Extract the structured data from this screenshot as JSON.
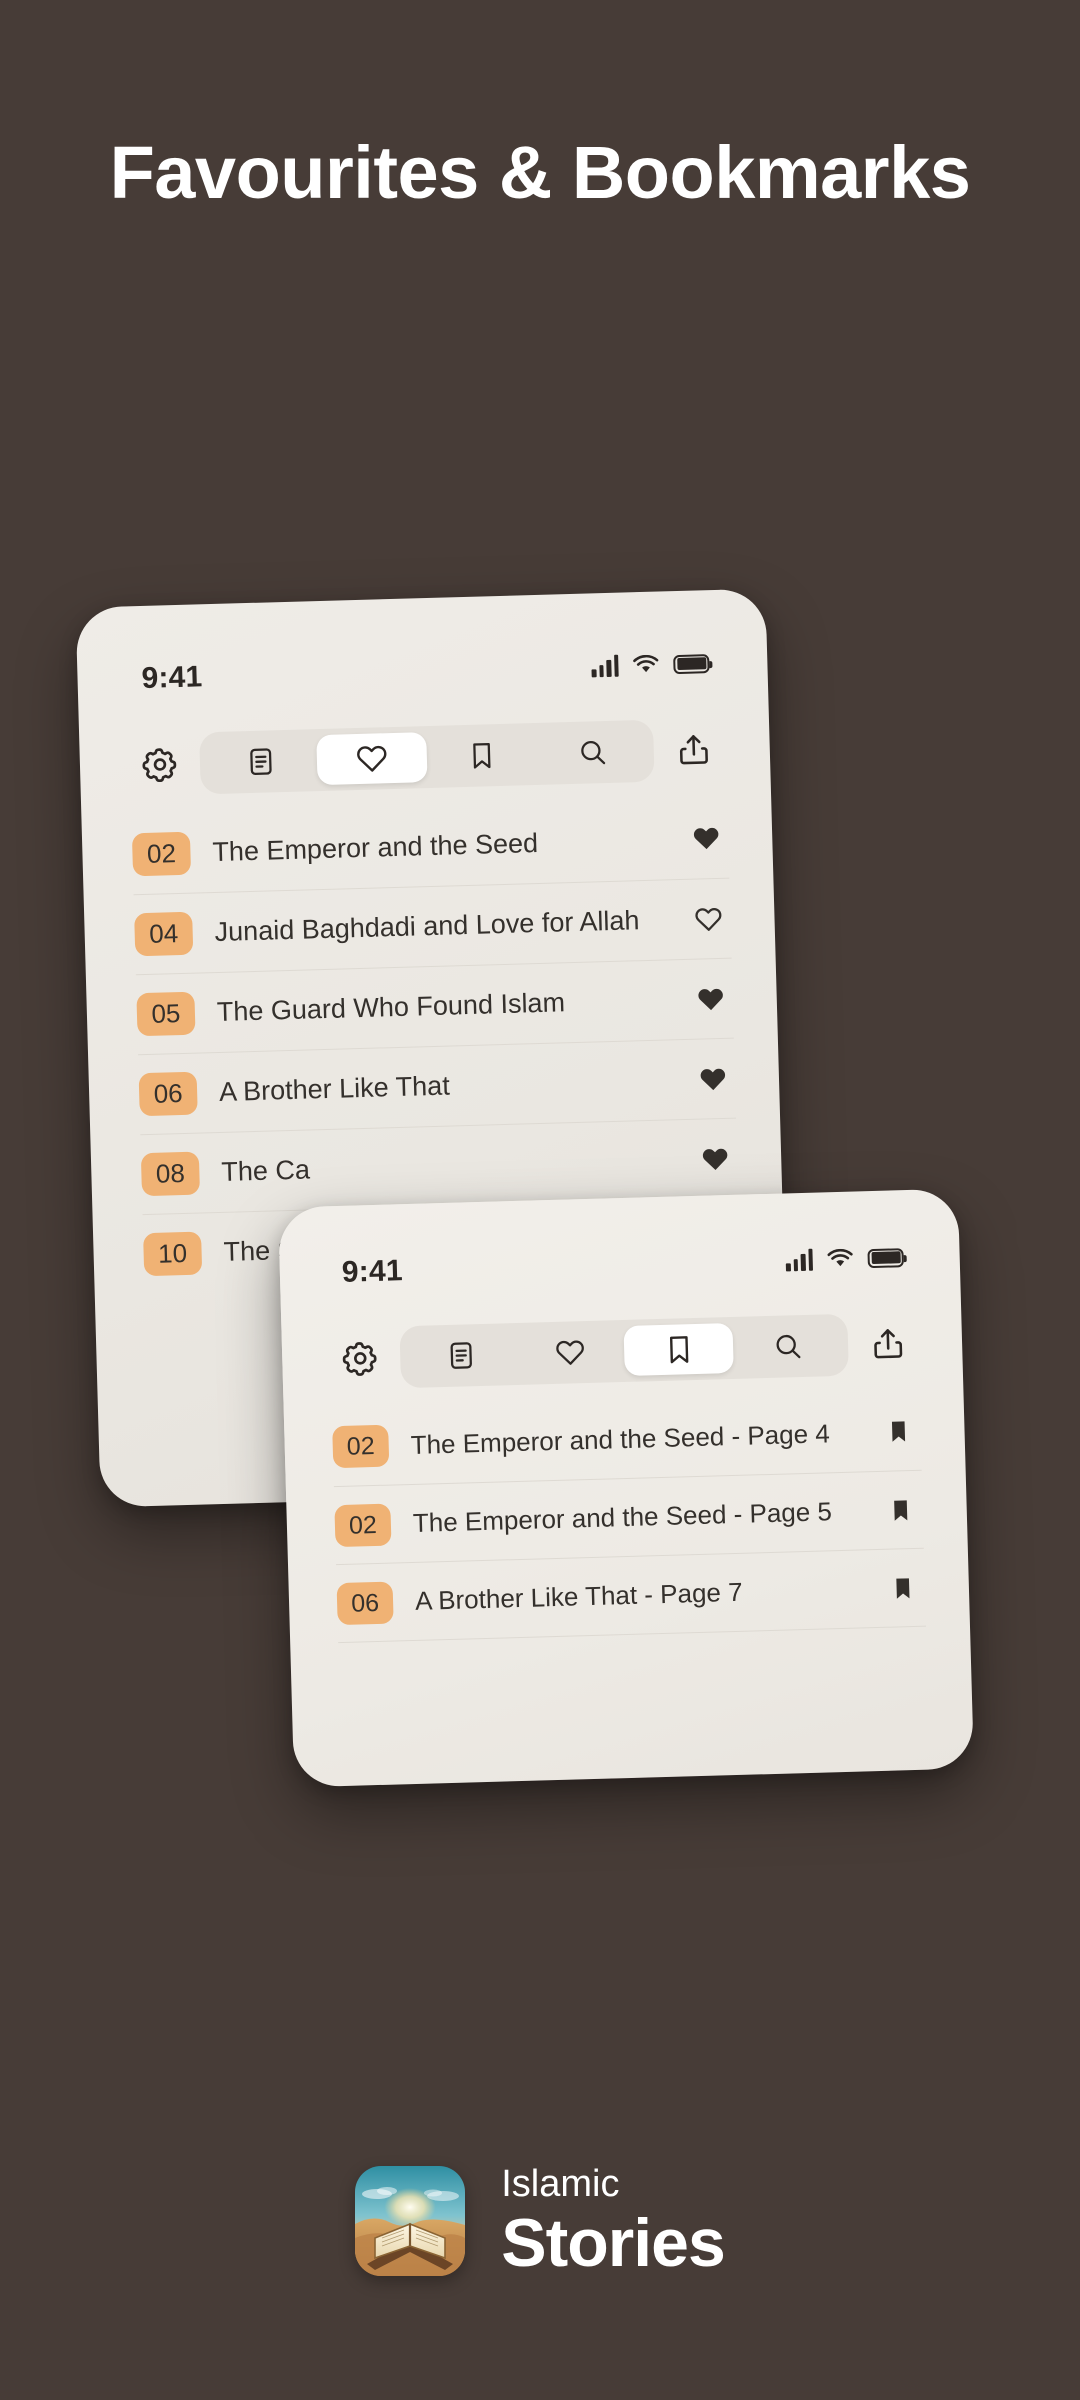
{
  "headline": "Favourites & Bookmarks",
  "colors": {
    "background": "#473c37",
    "card": "#efece7",
    "badge": "#f0b274",
    "text": "#34302c",
    "accent_white": "#ffffff"
  },
  "phone_favourites": {
    "status": {
      "time": "9:41",
      "signal_icon": "cellular-signal-icon",
      "wifi_icon": "wifi-icon",
      "battery_icon": "battery-icon"
    },
    "toolbar": {
      "settings_icon": "gear-icon",
      "share_icon": "share-icon",
      "tabs": [
        {
          "icon": "document-icon",
          "name": "stories",
          "active": false
        },
        {
          "icon": "heart-icon",
          "name": "favourites",
          "active": true
        },
        {
          "icon": "bookmark-icon",
          "name": "bookmarks",
          "active": false
        },
        {
          "icon": "search-icon",
          "name": "search",
          "active": false
        }
      ]
    },
    "rows": [
      {
        "number": "02",
        "title": "The Emperor and the Seed",
        "action_icon": "heart-filled-icon",
        "filled": true
      },
      {
        "number": "04",
        "title": "Junaid Baghdadi and Love for Allah",
        "action_icon": "heart-outline-icon",
        "filled": false
      },
      {
        "number": "05",
        "title": "The Guard Who Found Islam",
        "action_icon": "heart-filled-icon",
        "filled": true
      },
      {
        "number": "06",
        "title": "A Brother Like That",
        "action_icon": "heart-filled-icon",
        "filled": true
      },
      {
        "number": "08",
        "title": "The Ca",
        "action_icon": "heart-filled-icon",
        "filled": true
      },
      {
        "number": "10",
        "title": "The Si",
        "action_icon": "heart-filled-icon",
        "filled": true
      }
    ]
  },
  "phone_bookmarks": {
    "status": {
      "time": "9:41",
      "signal_icon": "cellular-signal-icon",
      "wifi_icon": "wifi-icon",
      "battery_icon": "battery-icon"
    },
    "toolbar": {
      "settings_icon": "gear-icon",
      "share_icon": "share-icon",
      "tabs": [
        {
          "icon": "document-icon",
          "name": "stories",
          "active": false
        },
        {
          "icon": "heart-icon",
          "name": "favourites",
          "active": false
        },
        {
          "icon": "bookmark-icon",
          "name": "bookmarks",
          "active": true
        },
        {
          "icon": "search-icon",
          "name": "search",
          "active": false
        }
      ]
    },
    "rows": [
      {
        "number": "02",
        "title": "The Emperor and the Seed - Page 4",
        "action_icon": "bookmark-filled-icon"
      },
      {
        "number": "02",
        "title": "The Emperor and the Seed - Page 5",
        "action_icon": "bookmark-filled-icon"
      },
      {
        "number": "06",
        "title": "A Brother Like That - Page 7",
        "action_icon": "bookmark-filled-icon"
      }
    ]
  },
  "footer": {
    "app_icon": "islamic-stories-app-icon",
    "brand_line1": "Islamic",
    "brand_line2": "Stories"
  }
}
